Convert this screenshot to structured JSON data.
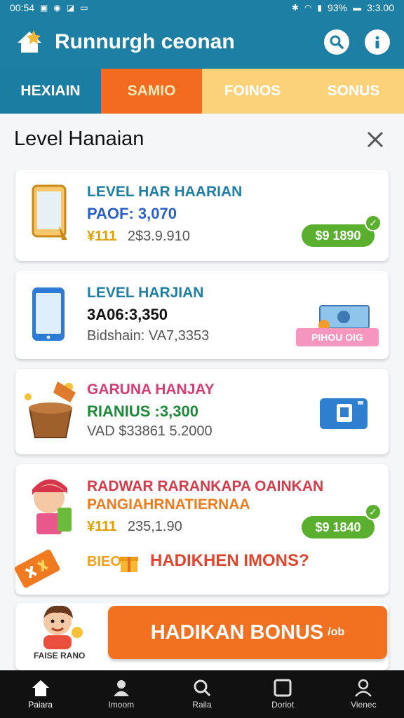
{
  "status_bar": {
    "time_left": "00:54",
    "battery": "93%",
    "time_right": "3:3.00"
  },
  "app": {
    "title": "Runnurgh ceonan",
    "logo_icon": "star-house-icon",
    "search_icon": "search-icon",
    "info_icon": "info-icon"
  },
  "tabs": [
    {
      "label": "HEXIAIN"
    },
    {
      "label": "SAMIO"
    },
    {
      "label": "FOINOS"
    },
    {
      "label": "SONUS"
    }
  ],
  "section": {
    "title": "Level Hanaian",
    "close_icon": "close-icon"
  },
  "cards": [
    {
      "icon": "tablet-icon",
      "title": "LEVEL HAR HAARIAN",
      "line2": "PAOF: 3,070",
      "line3_prefix": "¥111",
      "line3": "2$3.9.910",
      "badge": "$9 1890",
      "check": "✓"
    },
    {
      "icon": "phone-icon",
      "title": "LEVEL HARJIAN",
      "line2": "3A06:3,350",
      "line3": "Bidshain: VA7,3353",
      "tag": "PIHOU OIG"
    },
    {
      "icon": "basket-icon",
      "title": "GARUNA HANJAY",
      "line2": "RIANIUS :3,300",
      "line3": "VAD  $33861 5.2000",
      "action_icon": "camera-icon"
    },
    {
      "icon": "character-icon",
      "title": "RADWAR RARANKAPA OAINKAN",
      "subtitle": "PANGIAHRNATIERNAA",
      "line3_prefix": "¥111",
      "line3": "235,1.90",
      "badge": "$9 1840",
      "check": "✓",
      "promo": "HADIKHEN IMONS?",
      "promo_icon": "gift-box-icon",
      "promo_prefix": "BIEO"
    }
  ],
  "cta": {
    "label": "HADIKAN BONUS",
    "suffix": "/ob",
    "caption": "FAISE RANO",
    "mascot_icon": "mascot-icon"
  },
  "bottom_nav": [
    {
      "label": "Paiara",
      "icon": "home-icon"
    },
    {
      "label": "Imoom",
      "icon": "person-icon"
    },
    {
      "label": "Raila",
      "icon": "search-icon"
    },
    {
      "label": "Doriot",
      "icon": "square-icon"
    },
    {
      "label": "Vienec",
      "icon": "user-icon"
    }
  ],
  "colors": {
    "primary": "#1d7fa3",
    "accent": "#f27121",
    "success": "#5aaf2e",
    "tab_yellow": "#fbd27a"
  }
}
